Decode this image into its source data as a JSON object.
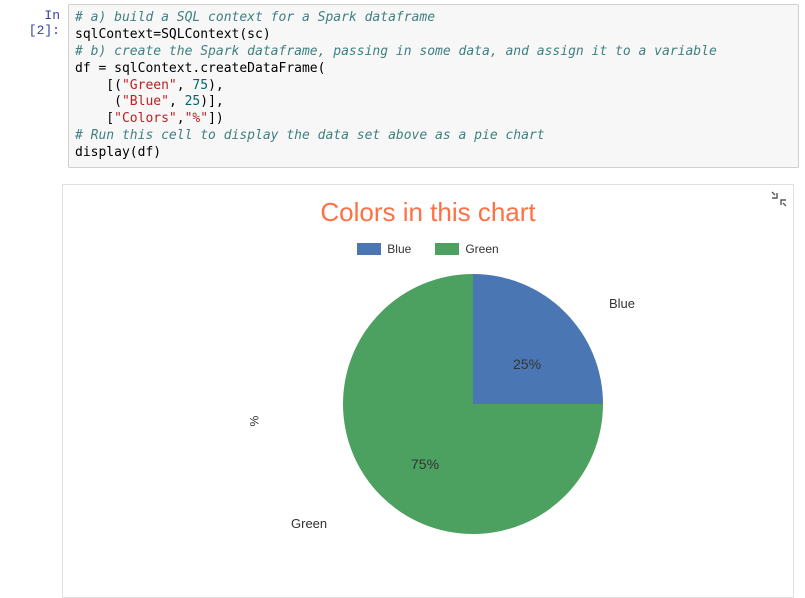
{
  "cell": {
    "prompt": "In [2]:",
    "code": {
      "line1_comment": "# a) build a SQL context for a Spark dataframe",
      "line2": "sqlContext=SQLContext(sc)",
      "line3_comment": "# b) create the Spark dataframe, passing in some data, and assign it to a variable",
      "line4": "df = sqlContext.createDataFrame(",
      "line5a": "    [(",
      "line5_green": "\"Green\"",
      "line5b": ", ",
      "line5_num": "75",
      "line5c": "),",
      "line6a": "     (",
      "line6_blue": "\"Blue\"",
      "line6b": ", ",
      "line6_num": "25",
      "line6c": ")],",
      "line7a": "    [",
      "line7_colors": "\"Colors\"",
      "line7b": ",",
      "line7_pct": "\"%\"",
      "line7c": "])",
      "line8_comment": "# Run this cell to display the data set above as a pie chart",
      "line9": "display(df)"
    }
  },
  "chart": {
    "title": "Colors in this chart",
    "yaxis": "%",
    "legend": [
      {
        "name": "Blue",
        "color": "#4A77B4"
      },
      {
        "name": "Green",
        "color": "#4CA060"
      }
    ],
    "slices": {
      "blue": {
        "label": "Blue",
        "pct": "25%"
      },
      "green": {
        "label": "Green",
        "pct": "75%"
      }
    }
  },
  "chart_data": {
    "type": "pie",
    "title": "Colors in this chart",
    "ylabel": "%",
    "categories": [
      "Blue",
      "Green"
    ],
    "values": [
      25,
      75
    ],
    "colors": [
      "#4A77B4",
      "#4CA060"
    ]
  }
}
